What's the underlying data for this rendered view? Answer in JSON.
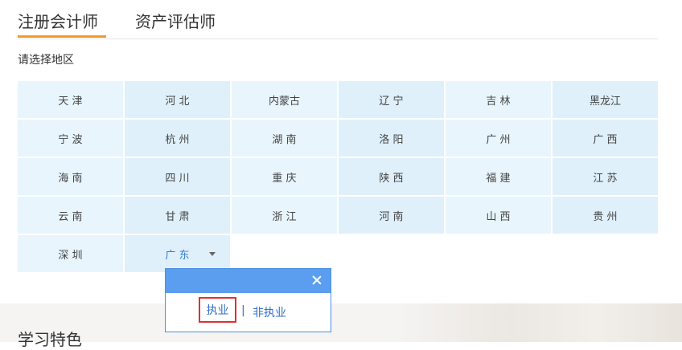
{
  "tabs": [
    {
      "label": "注册会计师"
    },
    {
      "label": "资产评估师"
    }
  ],
  "region_prompt": "请选择地区",
  "regions": [
    [
      "天 津",
      "河 北",
      "内蒙古",
      "辽 宁",
      "吉 林",
      "黑龙江"
    ],
    [
      "宁 波",
      "杭 州",
      "湖 南",
      "洛 阳",
      "广 州",
      "广 西"
    ],
    [
      "海 南",
      "四 川",
      "重 庆",
      "陕 西",
      "福 建",
      "江 苏"
    ],
    [
      "云 南",
      "甘 肃",
      "浙 江",
      "河 南",
      "山 西",
      "贵 州"
    ],
    [
      "深 圳",
      "广 东"
    ]
  ],
  "selected_region": "广 东",
  "popup": {
    "options": [
      "执业",
      "非执业"
    ],
    "separator": "|"
  },
  "section_title": "学习特色",
  "colors": {
    "accent_orange": "#f59a23",
    "popup_blue": "#5b9ef0",
    "link_blue": "#2f6fc9",
    "highlight_red": "#e03030"
  }
}
